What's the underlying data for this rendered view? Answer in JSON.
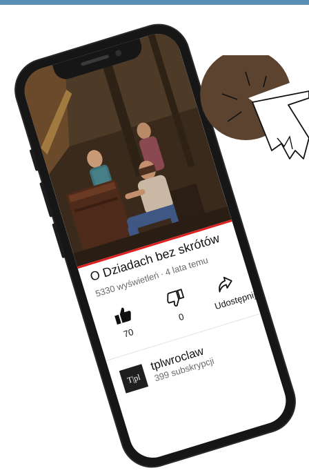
{
  "video": {
    "title": "O Dziadach bez skrótów",
    "views": "5330 wyświetleń",
    "age": "4 lata temu"
  },
  "actions": {
    "likes": "70",
    "dislikes": "0",
    "share_label": "Udostępnij"
  },
  "channel": {
    "name": "tplwroclaw",
    "subscribers": "399 subskrypcji",
    "logo_text": "T|pl"
  },
  "icons": [
    "thumbs-up-icon",
    "thumbs-down-icon",
    "share-icon",
    "click-cursor-icon"
  ],
  "colors": {
    "top_bar": "#5a8fb4",
    "progress": "#e02020",
    "cursor_circle": "#5b4330"
  }
}
